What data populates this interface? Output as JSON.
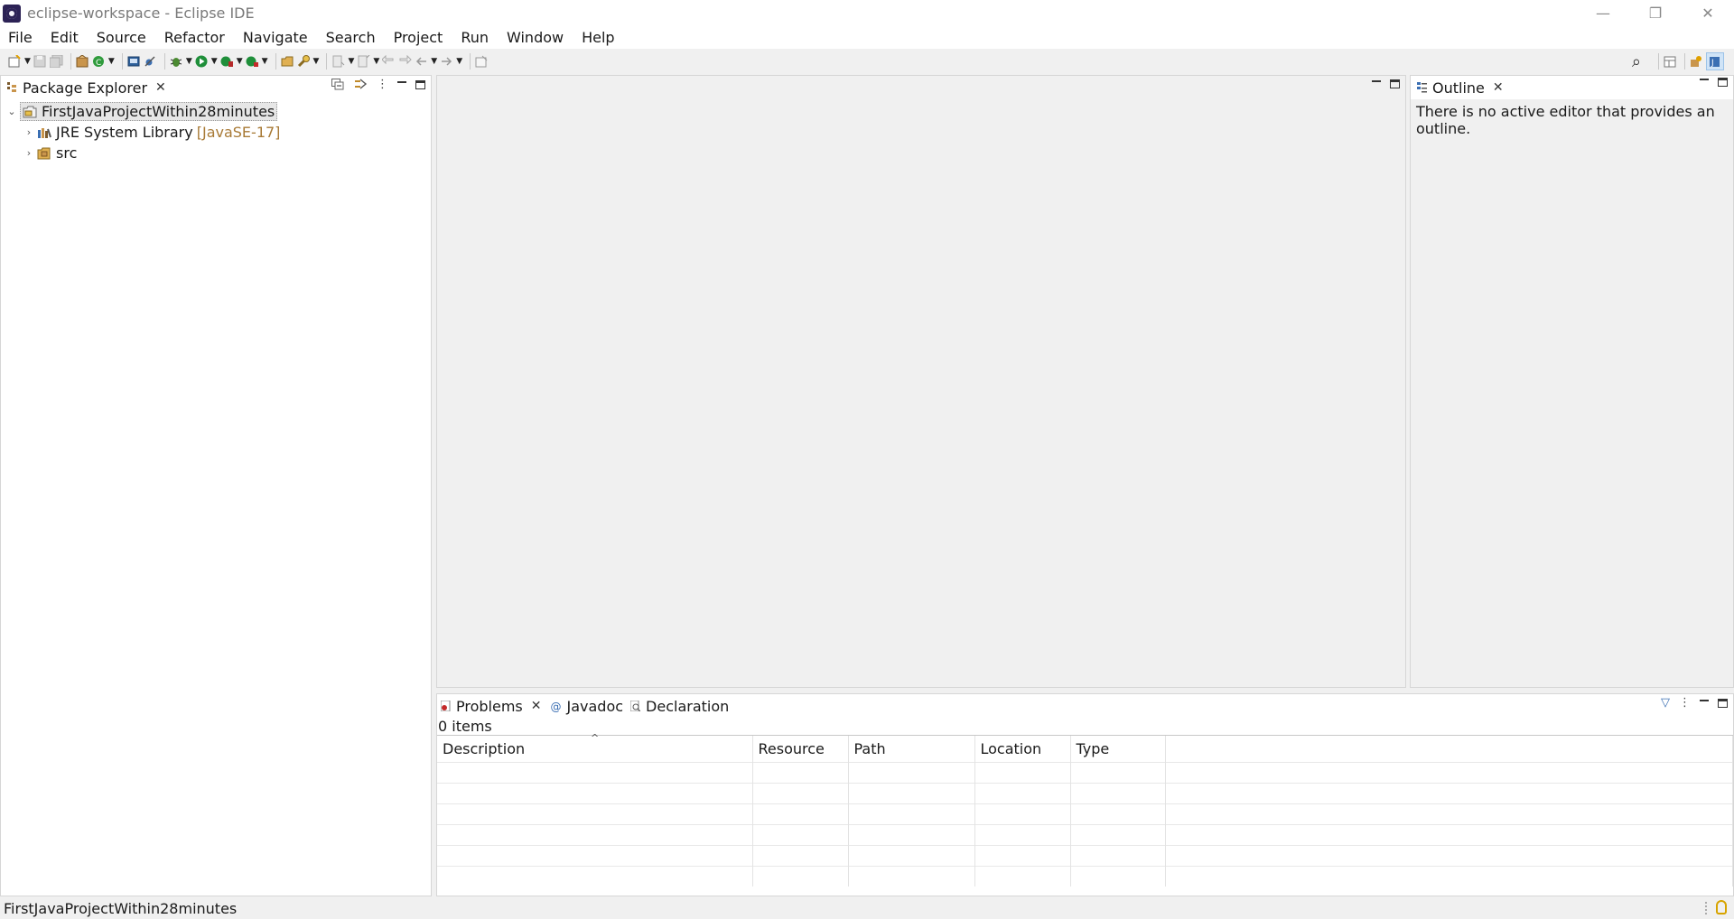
{
  "window": {
    "title": "eclipse-workspace - Eclipse IDE",
    "controls": {
      "minimize": "—",
      "restore": "❐",
      "close": "✕"
    }
  },
  "menu": [
    "File",
    "Edit",
    "Source",
    "Refactor",
    "Navigate",
    "Search",
    "Project",
    "Run",
    "Window",
    "Help"
  ],
  "package_explorer": {
    "tab_label": "Package Explorer",
    "close_glyph": "✕",
    "project": {
      "name": "FirstJavaProjectWithin28minutes",
      "expanded_glyph": "⌄",
      "children": [
        {
          "label": "JRE System Library",
          "decoration": "[JavaSE-17]",
          "glyph": "›"
        },
        {
          "label": "src",
          "glyph": "›"
        }
      ]
    },
    "view_menu_glyph": "⋮"
  },
  "outline": {
    "tab_label": "Outline",
    "close_glyph": "✕",
    "message": "There is no active editor that provides an outline."
  },
  "problems": {
    "tabs": [
      {
        "label": "Problems",
        "close_glyph": "✕"
      },
      {
        "label": "Javadoc"
      },
      {
        "label": "Declaration"
      }
    ],
    "count_text": "0 items",
    "sort_glyph": "^",
    "view_menu_glyph": "⋮",
    "filter_glyph": "▽",
    "columns": [
      "Description",
      "Resource",
      "Path",
      "Location",
      "Type"
    ],
    "empty_rows": 6
  },
  "status_bar": {
    "text": "FirstJavaProjectWithin28minutes"
  },
  "toolbar": {
    "search_glyph": "⌕"
  },
  "colors": {
    "accent_selection": "#e6e6e6",
    "decoration": "#a87a36",
    "bulb": "#d7a400"
  }
}
